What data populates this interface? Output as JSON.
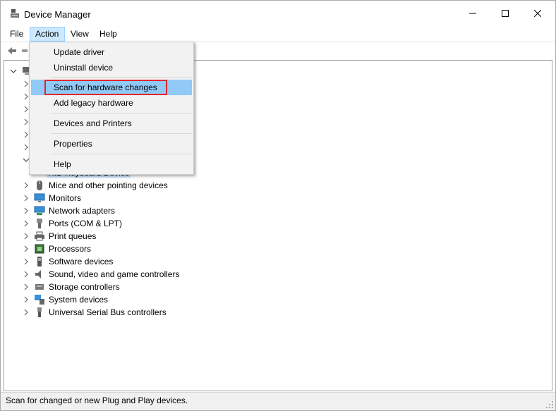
{
  "window": {
    "title": "Device Manager"
  },
  "menu": {
    "file": "File",
    "action": "Action",
    "view": "View",
    "help": "Help"
  },
  "action_menu": {
    "items": [
      {
        "label": "Update driver",
        "state": "normal"
      },
      {
        "label": "Uninstall device",
        "state": "normal"
      },
      {
        "label": "Scan for hardware changes",
        "state": "hovered"
      },
      {
        "label": "Add legacy hardware",
        "state": "normal"
      },
      {
        "label": "Devices and Printers",
        "state": "normal"
      },
      {
        "label": "Properties",
        "state": "normal"
      },
      {
        "label": "Help",
        "state": "normal"
      }
    ],
    "highlight_color": "#e0262d",
    "hover_color": "#91c9f7"
  },
  "tree": {
    "partial_child_label": "HID Keyboard Device",
    "categories": [
      {
        "label": "Mice and other pointing devices",
        "icon": "mouse-icon"
      },
      {
        "label": "Monitors",
        "icon": "monitor-icon"
      },
      {
        "label": "Network adapters",
        "icon": "network-adapter-icon"
      },
      {
        "label": "Ports (COM & LPT)",
        "icon": "port-icon"
      },
      {
        "label": "Print queues",
        "icon": "printer-icon"
      },
      {
        "label": "Processors",
        "icon": "processor-icon"
      },
      {
        "label": "Software devices",
        "icon": "software-device-icon"
      },
      {
        "label": "Sound, video and game controllers",
        "icon": "speaker-icon"
      },
      {
        "label": "Storage controllers",
        "icon": "storage-controller-icon"
      },
      {
        "label": "System devices",
        "icon": "system-device-icon"
      },
      {
        "label": "Universal Serial Bus controllers",
        "icon": "usb-icon"
      }
    ]
  },
  "status": {
    "text": "Scan for changed or new Plug and Play devices."
  },
  "colors": {
    "menu_active_bg": "#cce8ff",
    "selection_bg": "#cce8ff"
  }
}
